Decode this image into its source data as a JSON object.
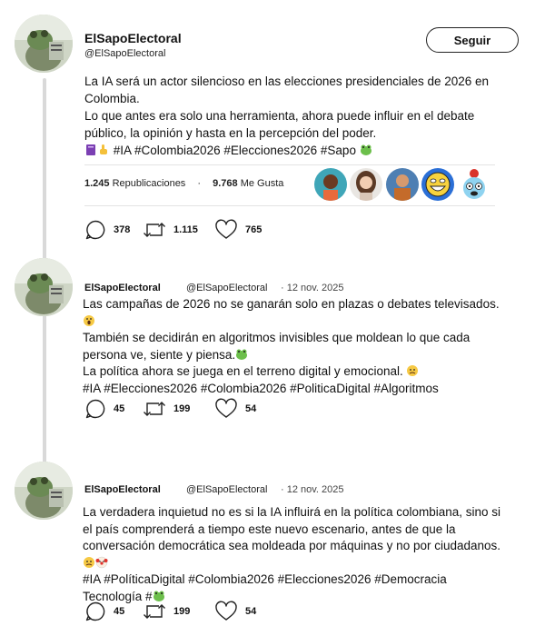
{
  "main": {
    "name": "ElSapoElectoral",
    "handle": "@ElSapoElectoral",
    "follow_label": "Seguir",
    "text_lines": [
      "La IA será un actor silencioso en las elecciones presidenciales de 2026 en",
      "Colombia.",
      "Lo que antes era solo una herramienta, ahora puede influir en el debate",
      "público, la opinión y hasta en la percepción del poder."
    ],
    "hashtags_line": " #IA #Colombia2026 #Elecciones2026  #Sapo ",
    "retweets_count": "1.245",
    "retweets_label": "Republicaciones",
    "stats_sep": "·",
    "likes_count": "9.768",
    "likes_label": "Me Gusta",
    "replies": "378",
    "retweets": "1.115",
    "likes": "765"
  },
  "reply1": {
    "name": "ElSapoElectoral",
    "handle": "@ElSapoElectoral",
    "date": "· 12 nov. 2025",
    "text_lines": [
      "Las campañas de 2026 no se ganarán solo en plazas o debates televisados.",
      "",
      "También se decidirán en algoritmos invisibles que moldean lo que cada",
      "persona ve, siente y piensa.",
      "La política ahora se juega en el terreno digital y emocional. ",
      "#IA #Elecciones2026 #Colombia2026 #PoliticaDigital #Algoritmos"
    ],
    "replies": "45",
    "retweets": "199",
    "likes": "54"
  },
  "reply2": {
    "name": "ElSapoElectoral",
    "handle": "@ElSapoElectoral",
    "date": "· 12 nov. 2025",
    "text_lines": [
      "La verdadera inquietud no es si la IA influirá en la política colombiana, sino si",
      "el país comprenderá a tiempo este nuevo escenario, antes de que la",
      "conversación democrática sea moldeada por máquinas y no por ciudadanos.",
      "",
      "#IA #PolíticaDigital #Colombia2026 #Elecciones2026 #Democracia",
      "Tecnología #"
    ],
    "replies": "45",
    "retweets": "199",
    "likes": "54"
  },
  "icons": {
    "reply": "comment-bubble-icon",
    "retweet": "retweet-arrows-icon",
    "like": "heart-outline-icon",
    "frog": "frog-emoji",
    "scream": "screaming-face-emoji",
    "worried": "worried-face-emoji",
    "clown": "clown-face-emoji"
  },
  "colors": {
    "frog": "#6cbf4b",
    "avatar_bg": "#cfd6c6",
    "separator": "#e3e3e3"
  }
}
